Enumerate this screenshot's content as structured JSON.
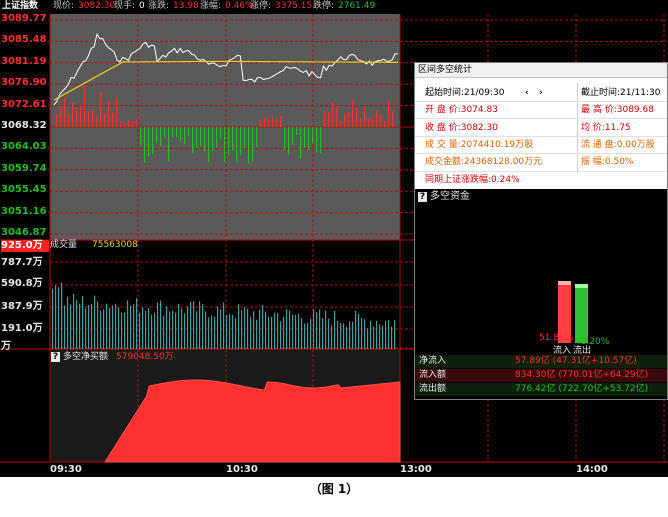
{
  "topbar": {
    "index_name": "上证指数",
    "price_label": "现价:",
    "price_value": "3082.30",
    "hand_label": "现手:",
    "hand_value": "0",
    "change_label": "涨跌:",
    "change_value": "13.98",
    "pct_label": "涨幅:",
    "pct_value": "0.46%",
    "up_stop_label": "涨停:",
    "up_stop_value": "3375.15",
    "down_stop_label": "跌停:",
    "down_stop_value": "2761.49"
  },
  "price_axis": {
    "labels": [
      "3089.77",
      "3085.48",
      "3081.19",
      "3076.90",
      "3072.61",
      "3068.32",
      "3064.03",
      "3059.74",
      "3055.45",
      "3051.16",
      "3046.87"
    ],
    "label_colors": [
      "#ff3030",
      "#ff3030",
      "#ff3030",
      "#ff3030",
      "#ff3030",
      "#e8e8e8",
      "#20c020",
      "#20c020",
      "#20c020",
      "#20c020",
      "#20c020"
    ]
  },
  "volume_panel": {
    "label": "成交量",
    "value": "75563008",
    "axis_labels": [
      "925.0万",
      "787.7万",
      "590.8万",
      "387.9万",
      "191.0万",
      "万"
    ]
  },
  "net_panel": {
    "icon": "?",
    "label": "多空净买额",
    "value": "579048.50万"
  },
  "time_axis": [
    "09:30",
    "10:30",
    "13:00",
    "14:00"
  ],
  "popup": {
    "title": "区间多空统计",
    "start_label": "起始时间:21/09:30",
    "prev_arrow": "‹",
    "next_arrow": "›",
    "end_label": "截止时间:21/11:30",
    "open": "开 盘 价:3074.83",
    "high": "最 高 价:3089.68",
    "close": "收 盘 价:3082.30",
    "avg": "均    价:11.75",
    "volume": "成 交 量:2074410.19万股",
    "float": "流 通 盘:0.00万股",
    "amount": "成交金额:24368128.00万元",
    "swing": "振    幅:0.50%",
    "period_change": "同期上证涨跌幅:0.24%",
    "funds_title": "多空资金",
    "inflow_pct": "51.80%",
    "outflow_pct": "48.20%",
    "inflow_label": "流入",
    "outflow_label": "流出",
    "net_inflow": "净流入",
    "net_inflow_value": "57.89亿 (47.31亿+10.57亿)",
    "inflow_amount": "流入额",
    "inflow_amount_value": "834.30亿 (770.01亿+64.29亿)",
    "outflow_amount": "流出额",
    "outflow_amount_value": "776.42亿 (722.70亿+53.72亿)"
  },
  "caption": "（图 1）",
  "colors": {
    "up": "#ff3030",
    "down": "#20c020",
    "price_line": "#ffffff",
    "avg_line": "#e6d21e",
    "grid": "#b01010",
    "panel_bg": "#5a5a5a",
    "volume_bar": "#40a0a0"
  }
}
